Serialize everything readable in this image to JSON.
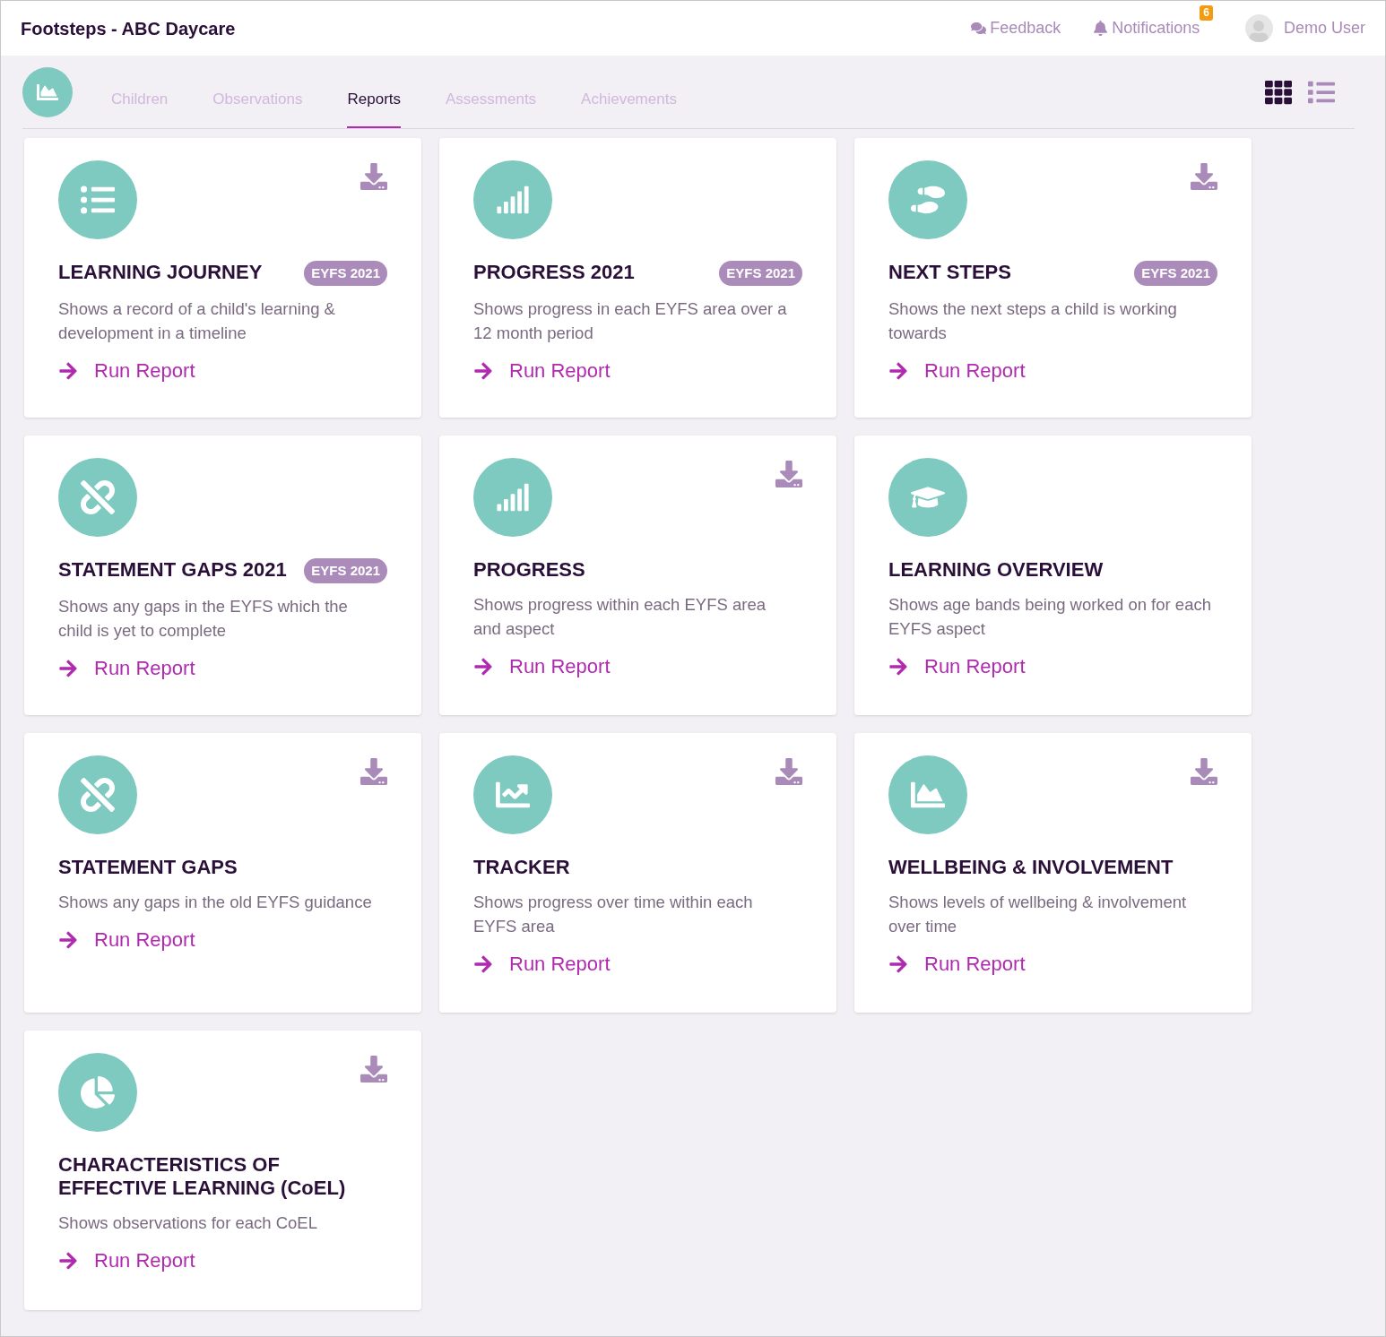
{
  "header": {
    "title": "Footsteps - ABC Daycare",
    "feedback": "Feedback",
    "notifications": "Notifications",
    "notification_count": "6",
    "user": "Demo User"
  },
  "tabs": [
    {
      "label": "Children",
      "selected": false
    },
    {
      "label": "Observations",
      "selected": false
    },
    {
      "label": "Reports",
      "selected": true
    },
    {
      "label": "Assessments",
      "selected": false
    },
    {
      "label": "Achievements",
      "selected": false
    }
  ],
  "views": [
    {
      "kind": "grid",
      "selected": true
    },
    {
      "kind": "list",
      "selected": false
    }
  ],
  "reports": [
    {
      "kind": "list",
      "title": "LEARNING JOURNEY",
      "badge": "EYFS 2021",
      "description": "Shows a record of a child's learning & development in a timeline",
      "action": "Run Report",
      "download": true
    },
    {
      "kind": "bars",
      "title": "PROGRESS 2021",
      "badge": "EYFS 2021",
      "description": "Shows progress in each EYFS area over a 12 month period",
      "action": "Run Report",
      "download": false
    },
    {
      "kind": "footsteps",
      "title": "NEXT STEPS",
      "badge": "EYFS 2021",
      "description": "Shows the next steps a child is working towards",
      "action": "Run Report",
      "download": true
    },
    {
      "kind": "unlink",
      "title": "STATEMENT GAPS 2021",
      "badge": "EYFS 2021",
      "description": "Shows any gaps in the EYFS which the child is yet to complete",
      "action": "Run Report",
      "download": false
    },
    {
      "kind": "bars",
      "title": "PROGRESS",
      "description": "Shows progress within each EYFS area and aspect",
      "action": "Run Report",
      "download": true
    },
    {
      "kind": "cap",
      "title": "LEARNING OVERVIEW",
      "description": "Shows age bands being worked on for each EYFS aspect",
      "action": "Run Report",
      "download": false
    },
    {
      "kind": "unlink",
      "title": "STATEMENT GAPS",
      "description": "Shows any gaps in the old EYFS guidance",
      "action": "Run Report",
      "download": true
    },
    {
      "kind": "line",
      "title": "TRACKER",
      "description": "Shows progress over time within each EYFS area",
      "action": "Run Report",
      "download": true
    },
    {
      "kind": "area",
      "title": "WELLBEING & INVOLVEMENT",
      "description": "Shows levels of wellbeing & involvement over time",
      "action": "Run Report",
      "download": true
    },
    {
      "kind": "pie",
      "title": "CHARACTERISTICS OF EFFECTIVE LEARNING (CoEL)",
      "description": "Shows observations for each CoEL",
      "action": "Run Report",
      "download": true
    }
  ]
}
